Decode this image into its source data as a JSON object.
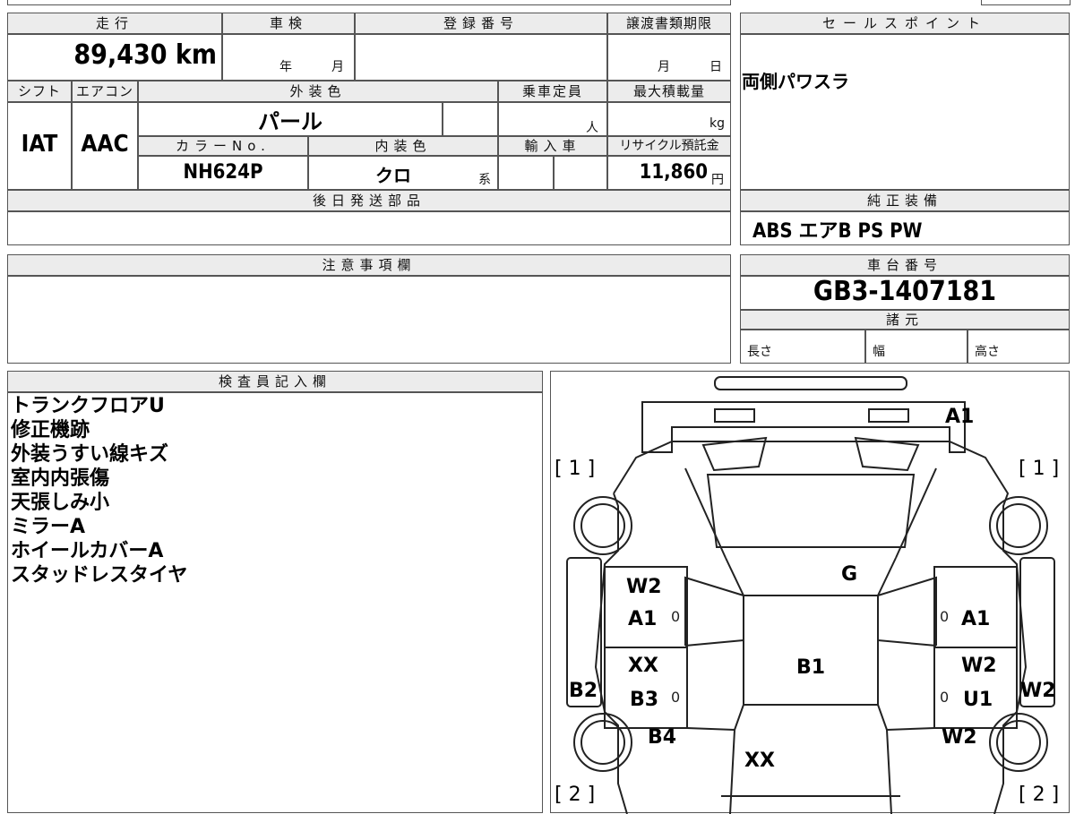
{
  "headers": {
    "mileage": "走行",
    "inspection": "車検",
    "registration": "登録番号",
    "transfer_deadline": "譲渡書類期限",
    "sales_point": "セールスポイント",
    "shift": "シフト",
    "aircon": "エアコン",
    "exterior_color": "外装色",
    "capacity": "乗車定員",
    "max_load": "最大積載量",
    "color_no": "カラーNo.",
    "interior_color": "内装色",
    "import": "輸入車",
    "recycle": "リサイクル預託金",
    "later_parts": "後日発送部品",
    "genuine_equipment": "純正装備",
    "notes": "注意事項欄",
    "chassis_no": "車台番号",
    "specs": "諸元",
    "inspector": "検査員記入欄"
  },
  "vehicle": {
    "mileage": "89,430 km",
    "inspection_year_unit": "年",
    "inspection_month_unit": "月",
    "transfer_month_unit": "月",
    "transfer_day_unit": "日",
    "shift": "IAT",
    "aircon": "AAC",
    "exterior_color": "パール",
    "capacity_unit": "人",
    "max_load_unit": "kg",
    "color_no": "NH624P",
    "interior_color": "クロ",
    "interior_suffix": "系",
    "recycle_fee": "11,860",
    "recycle_unit": "円",
    "sales_point": "両側パワスラ",
    "equipment": "ABS エアB PS PW",
    "chassis_no": "GB3-1407181",
    "spec_length": "長さ",
    "spec_width": "幅",
    "spec_height": "高さ"
  },
  "inspector_notes": [
    "トランクフロアU",
    "修正機跡",
    "外装うすい線キズ",
    "室内内張傷",
    "天張しみ小",
    "ミラーA",
    "ホイールカバーA",
    "スタッドレスタイヤ"
  ],
  "diagram": {
    "bracket_top_left": "[ 1 ]",
    "bracket_top_right": "[ 1 ]",
    "bracket_bottom_left": "[ 2 ]",
    "bracket_bottom_right": "[ 2 ]",
    "front": "A1",
    "windshield": "G",
    "left_front_door_1": "W2",
    "left_front_door_2": "A1",
    "left_rear_door_1": "XX",
    "left_rear_door_2": "B3",
    "left_side": "B2",
    "left_rear_quarter": "B4",
    "roof": "B1",
    "right_front_door": "A1",
    "right_rear_door_1": "W2",
    "right_rear_door_2": "U1",
    "right_side": "W2",
    "right_rear_quarter": "W2",
    "rear": "XX",
    "zero": "0"
  }
}
